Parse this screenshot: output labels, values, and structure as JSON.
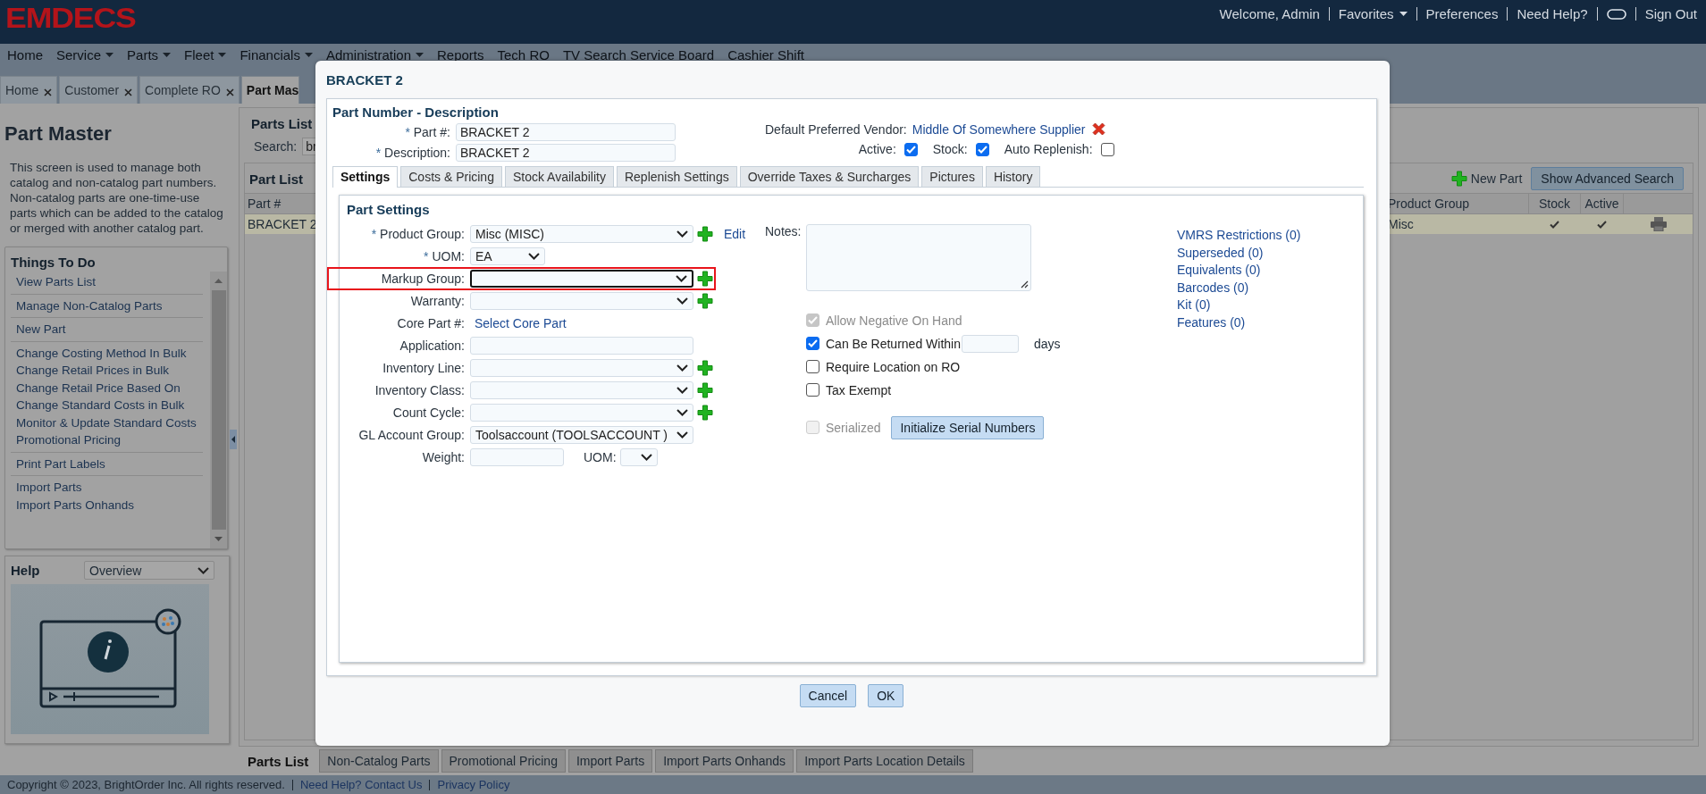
{
  "header": {
    "logo": "EMDECS",
    "user_menu": [
      {
        "kind": "text",
        "label": "Welcome, Admin"
      },
      {
        "kind": "menu",
        "label": "Favorites"
      },
      {
        "kind": "link",
        "label": "Preferences"
      },
      {
        "kind": "link",
        "label": "Need Help?"
      },
      {
        "kind": "icon"
      },
      {
        "kind": "link",
        "label": "Sign Out"
      }
    ]
  },
  "menu": [
    {
      "label": "Home",
      "dropdown": false
    },
    {
      "label": "Service",
      "dropdown": true
    },
    {
      "label": "Parts",
      "dropdown": true
    },
    {
      "label": "Fleet",
      "dropdown": true
    },
    {
      "label": "Financials",
      "dropdown": true
    },
    {
      "label": "Administration",
      "dropdown": true
    },
    {
      "label": "Reports",
      "dropdown": false
    },
    {
      "label": "Tech RO",
      "dropdown": false
    },
    {
      "label": "TV Search Service Board",
      "dropdown": false
    },
    {
      "label": "Cashier Shift",
      "dropdown": false
    }
  ],
  "page_tabs": [
    {
      "label": "Home",
      "closable": true,
      "selected": false
    },
    {
      "label": "Customer",
      "closable": true,
      "selected": false
    },
    {
      "label": "Complete RO",
      "closable": true,
      "selected": false
    },
    {
      "label": "Part Mas",
      "closable": false,
      "selected": true
    }
  ],
  "sidebar": {
    "title": "Part Master",
    "description": "This screen is used to manage both catalog and non-catalog part numbers. Non-catalog parts are one-time-use parts which can be added to the catalog or merged with another catalog part.",
    "things_to_do": {
      "title": "Things To Do",
      "groups": [
        [
          "View Parts List"
        ],
        [
          "Manage Non-Catalog Parts"
        ],
        [
          "New Part"
        ],
        [
          "Change Costing Method In Bulk",
          "Change Retail Prices in Bulk",
          "Change Retail Price Based On",
          "Change Standard Costs in Bulk",
          "Monitor & Update Standard Costs",
          "Promotional Pricing"
        ],
        [
          "Print Part Labels"
        ],
        [
          "Import Parts",
          "Import Parts Onhands"
        ]
      ]
    },
    "help": {
      "title": "Help",
      "topic": "Overview"
    }
  },
  "parts_list": {
    "title": "Parts List",
    "search_label": "Search:",
    "search_value": "br",
    "part_list": {
      "title": "Part List",
      "new_part": "New Part",
      "advanced_search": "Show Advanced Search",
      "columns": [
        "Part #",
        "Product Group",
        "Stock",
        "Active"
      ],
      "rows": [
        {
          "part": "BRACKET 2",
          "product_group": "Misc",
          "stock": true,
          "active": true
        }
      ]
    }
  },
  "dialog": {
    "title": "BRACKET 2",
    "section": "Part Number - Description",
    "identity": [
      {
        "mark": "*",
        "label": "Part #:",
        "value": "BRACKET 2"
      },
      {
        "mark": "*",
        "label": "Description:",
        "value": "BRACKET 2"
      }
    ],
    "vendor": {
      "label": "Default Preferred Vendor:",
      "value": "Middle Of Somewhere Supplier"
    },
    "flags": [
      {
        "label": "Active:",
        "checked": true
      },
      {
        "label": "Stock:",
        "checked": true
      },
      {
        "label": "Auto Replenish:",
        "checked": false
      }
    ],
    "tabs": [
      {
        "label": "Settings",
        "selected": true
      },
      {
        "label": "Costs & Pricing",
        "selected": false
      },
      {
        "label": "Stock Availability",
        "selected": false
      },
      {
        "label": "Replenish Settings",
        "selected": false
      },
      {
        "label": "Override Taxes & Surcharges",
        "selected": false
      },
      {
        "label": "Pictures",
        "selected": false
      },
      {
        "label": "History",
        "selected": false
      }
    ],
    "settings": {
      "heading": "Part Settings",
      "fields": [
        {
          "kind": "select",
          "mark": "*",
          "label": "Product Group:",
          "value": "Misc (MISC)",
          "add": true,
          "edit": "Edit",
          "highlighted": false,
          "focused": false
        },
        {
          "kind": "short_select",
          "mark": "*",
          "label": "UOM:",
          "value": "EA",
          "add": false,
          "highlighted": false,
          "focused": false
        },
        {
          "kind": "select",
          "label": "Markup Group:",
          "add": true,
          "highlighted": true,
          "focused": true
        },
        {
          "kind": "select",
          "label": "Warranty:",
          "add": true,
          "highlighted": false,
          "focused": false
        },
        {
          "kind": "link",
          "label": "Core Part #:",
          "value": "Select Core Part"
        },
        {
          "kind": "input",
          "label": "Application:"
        },
        {
          "kind": "select",
          "label": "Inventory Line:",
          "add": true,
          "highlighted": false,
          "focused": false
        },
        {
          "kind": "select",
          "label": "Inventory Class:",
          "add": true,
          "highlighted": false,
          "focused": false
        },
        {
          "kind": "select",
          "label": "Count Cycle:",
          "add": true,
          "highlighted": false,
          "focused": false
        },
        {
          "kind": "select",
          "label": "GL Account Group:",
          "value": "Toolsaccount (TOOLSACCOUNT )",
          "add": false,
          "highlighted": false,
          "focused": false
        },
        {
          "kind": "weight",
          "label": "Weight:",
          "uom_label": "UOM:"
        }
      ],
      "notes_label": "Notes:",
      "options": [
        {
          "label": "Allow Negative On Hand",
          "checked": true,
          "disabled": true
        },
        {
          "label": "Can Be Returned Within",
          "checked": true,
          "disabled": false,
          "suffix": "days"
        },
        {
          "label": "Require Location on RO",
          "checked": false,
          "disabled": false
        },
        {
          "label": "Tax Exempt",
          "checked": false,
          "disabled": false
        }
      ],
      "serialized": {
        "label": "Serialized",
        "checked": false,
        "disabled": true,
        "button": "Initialize Serial Numbers"
      },
      "links": [
        "VMRS Restrictions (0)",
        "Superseded (0)",
        "Equivalents (0)",
        "Barcodes (0)",
        "Kit (0)",
        "Features (0)"
      ]
    },
    "buttons": [
      "Cancel",
      "OK"
    ]
  },
  "bottom_tabs": [
    {
      "label": "Parts List",
      "selected": true
    },
    {
      "label": "Non-Catalog Parts",
      "selected": false
    },
    {
      "label": "Promotional Pricing",
      "selected": false
    },
    {
      "label": "Import Parts",
      "selected": false
    },
    {
      "label": "Import Parts Onhands",
      "selected": false
    },
    {
      "label": "Import Parts Location Details",
      "selected": false
    }
  ],
  "footer": {
    "copyright": "Copyright © 2023, BrightOrder Inc. All rights reserved.",
    "links": [
      "Need Help? Contact Us",
      "Privacy Policy"
    ]
  }
}
